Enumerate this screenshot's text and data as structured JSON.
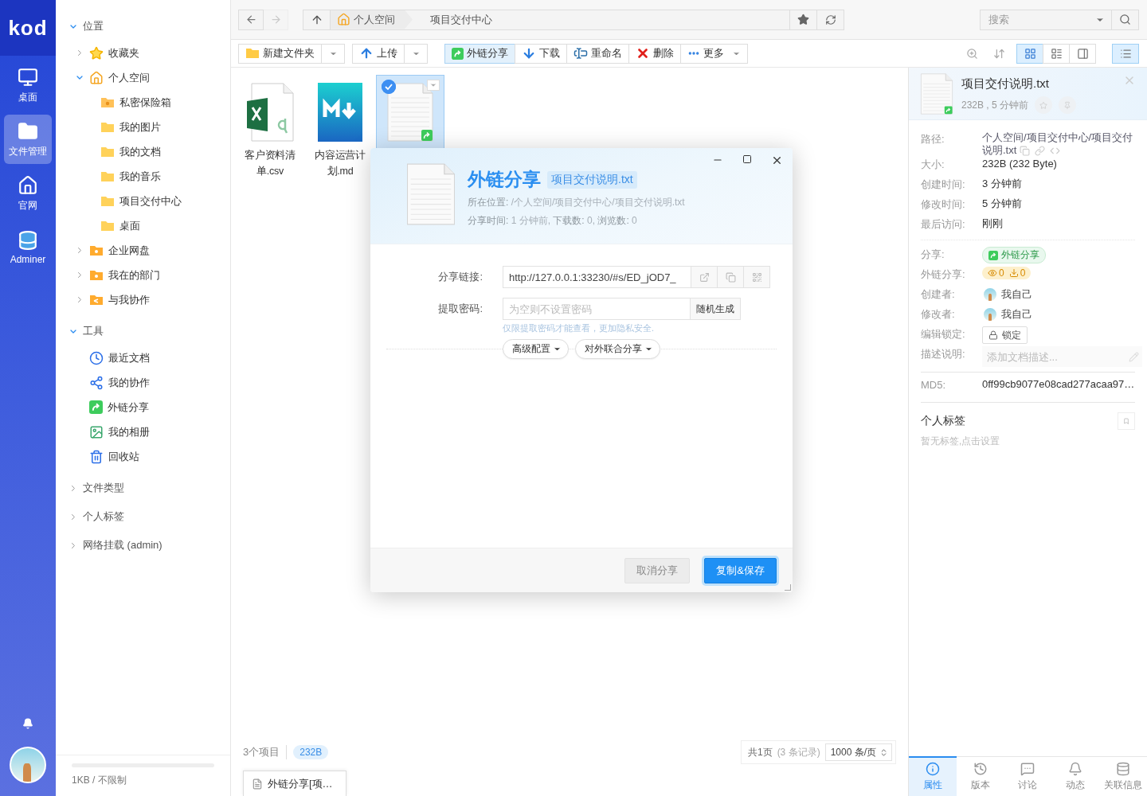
{
  "rail": {
    "logo": "kod",
    "items": [
      {
        "label": "桌面",
        "selected": false
      },
      {
        "label": "文件管理",
        "selected": true
      },
      {
        "label": "官网",
        "selected": false
      },
      {
        "label": "Adminer",
        "selected": false
      }
    ]
  },
  "sidebar": {
    "sections": [
      {
        "label": "位置",
        "expanded": true,
        "children": [
          {
            "label": "收藏夹",
            "kind": "star",
            "expanded": false
          },
          {
            "label": "个人空间",
            "kind": "home",
            "expanded": true,
            "children": [
              {
                "label": "私密保险箱",
                "kind": "safe"
              },
              {
                "label": "我的图片",
                "kind": "folder"
              },
              {
                "label": "我的文档",
                "kind": "folder"
              },
              {
                "label": "我的音乐",
                "kind": "folder"
              },
              {
                "label": "项目交付中心",
                "kind": "folder"
              },
              {
                "label": "桌面",
                "kind": "folder"
              }
            ]
          },
          {
            "label": "企业网盘",
            "kind": "group-folder",
            "expanded": false
          },
          {
            "label": "我在的部门",
            "kind": "group-folder",
            "expanded": false
          },
          {
            "label": "与我协作",
            "kind": "share-folder",
            "expanded": false
          }
        ]
      },
      {
        "label": "工具",
        "expanded": true,
        "children": [
          {
            "label": "最近文档",
            "kind": "clock"
          },
          {
            "label": "我的协作",
            "kind": "collab"
          },
          {
            "label": "外链分享",
            "kind": "share"
          },
          {
            "label": "我的相册",
            "kind": "album"
          },
          {
            "label": "回收站",
            "kind": "trash"
          }
        ]
      },
      {
        "label": "文件类型",
        "expanded": false
      },
      {
        "label": "个人标签",
        "expanded": false
      },
      {
        "label": "网络挂载 (admin)",
        "expanded": false
      }
    ],
    "storage": {
      "text": "1KB / 不限制",
      "level": 0
    }
  },
  "nav": {
    "history": [
      {
        "disabled": false
      },
      {
        "disabled": true
      }
    ],
    "breadcrumbs": [
      "个人空间",
      "项目交付中心"
    ],
    "search": {
      "placeholder": "搜索"
    }
  },
  "toolbar": {
    "left": [
      {
        "label": "新建文件夹",
        "kind": "new-folder",
        "dropdown": true
      },
      {
        "label": "上传",
        "kind": "upload",
        "dropdown": true
      }
    ],
    "actions": [
      {
        "label": "外链分享",
        "kind": "share",
        "selected": true,
        "dropdown": false
      },
      {
        "label": "下载",
        "kind": "download",
        "selected": false,
        "dropdown": false
      },
      {
        "label": "重命名",
        "kind": "rename",
        "selected": false,
        "dropdown": false
      },
      {
        "label": "删除",
        "kind": "delete",
        "selected": false,
        "dropdown": false
      },
      {
        "label": "更多",
        "kind": "more",
        "selected": false,
        "dropdown": true
      }
    ],
    "views": [
      {
        "selected": true
      },
      {
        "selected": false
      },
      {
        "selected": false
      }
    ],
    "panel_toggle": {
      "selected": true
    }
  },
  "files": [
    {
      "name": "客户资料清单.csv",
      "kind": "excel",
      "selected": false
    },
    {
      "name": "内容运营计划.md",
      "kind": "markdown",
      "selected": false
    },
    {
      "kind": "text",
      "selected": true
    }
  ],
  "status": {
    "count": "3个项目",
    "size": "232B",
    "pages": "共1页",
    "records": "(3 条记录)",
    "per_page": "1000 条/页"
  },
  "taskbar": [
    {
      "label": "外链分享[项…"
    }
  ],
  "details": {
    "title": "项目交付说明.txt",
    "meta": "232B , 5 分钟前",
    "rows": [
      {
        "label": "路径:",
        "value": "个人空间/项目交付中心/项目交付说明.txt",
        "kind": "path"
      },
      {
        "label": "大小:",
        "value": "232B (232 Byte)",
        "kind": "text"
      },
      {
        "label": "创建时间:",
        "value": "3 分钟前",
        "kind": "text"
      },
      {
        "label": "修改时间:",
        "value": "5 分钟前",
        "kind": "text"
      },
      {
        "label": "最后访问:",
        "value": "刚刚",
        "kind": "text"
      }
    ],
    "share_rows": [
      {
        "label": "分享:",
        "kind": "share-tag",
        "value": "外链分享"
      },
      {
        "label": "外链分享:",
        "kind": "counts",
        "views": "0",
        "downloads": "0"
      },
      {
        "label": "创建者:",
        "kind": "user",
        "value": "我自己"
      },
      {
        "label": "修改者:",
        "kind": "user",
        "value": "我自己"
      },
      {
        "label": "编辑锁定:",
        "kind": "lock",
        "value": "锁定"
      },
      {
        "label": "描述说明:",
        "kind": "description",
        "placeholder": "添加文档描述..."
      }
    ],
    "md5": {
      "label": "MD5:",
      "value": "0ff99cb9077e08cad277acaa97…"
    },
    "tags": {
      "title": "个人标签",
      "hint": "暂无标签,点击设置"
    },
    "tabs": [
      {
        "label": "属性",
        "selected": true
      },
      {
        "label": "版本",
        "selected": false
      },
      {
        "label": "讨论",
        "selected": false
      },
      {
        "label": "动态",
        "selected": false
      },
      {
        "label": "关联信息",
        "selected": false
      }
    ]
  },
  "dialog": {
    "title": "外链分享",
    "file": "项目交付说明.txt",
    "location": "**所在位置:** /个人空间/项目交付中心/项目交付说明.txt",
    "stats": "**分享时间:** 1 分钟前, **下载数:** 0, **浏览数:** 0",
    "fields": [
      {
        "label": "分享链接:",
        "kind": "link",
        "value": "http://127.0.0.1:33230/#s/ED_jOD7_"
      },
      {
        "label": "提取密码:",
        "kind": "password",
        "placeholder": "为空则不设置密码",
        "button": "随机生成",
        "hint": "仅限提取密码才能查看，更加隐私安全."
      }
    ],
    "options": [
      "高级配置",
      "对外联合分享"
    ],
    "buttons": [
      {
        "label": "取消分享",
        "kind": "secondary"
      },
      {
        "label": "复制&保存",
        "kind": "primary"
      }
    ]
  }
}
